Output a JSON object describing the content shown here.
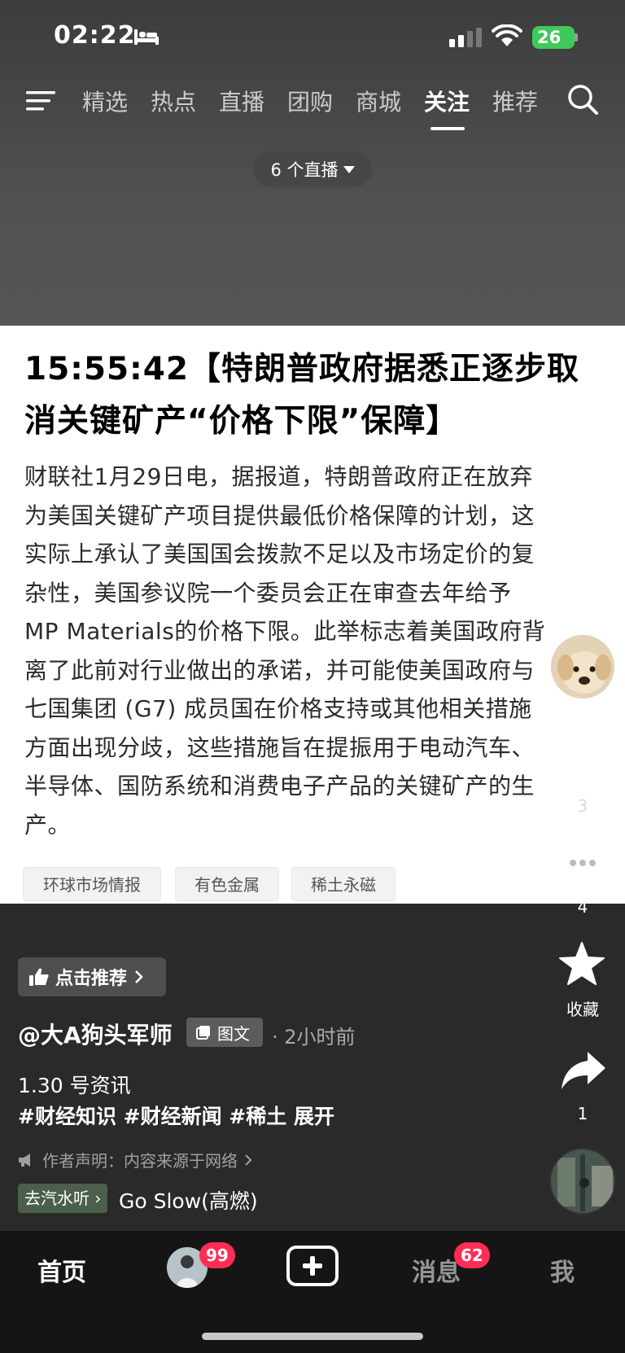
{
  "status_bar": {
    "time": "02:22",
    "battery": "26"
  },
  "nav": {
    "tabs": [
      "精选",
      "热点",
      "直播",
      "团购",
      "商城",
      "关注",
      "推荐"
    ],
    "active": "关注"
  },
  "live_pill": {
    "label": "6 个直播"
  },
  "article": {
    "title_line1": "15:55:42【特朗普政府据悉正逐步取",
    "title_line2": "消关键矿产“价格下限”保障】",
    "body_lines": [
      "财联社1月29日电，据报道，特朗普政府正在放弃",
      "为美国关键矿产项目提供最低价格保障的计划，这",
      "实际上承认了美国国会拨款不足以及市场定价的复",
      "杂性，美国参议院一个委员会正在审查去年给予",
      "MP Materials的价格下限。此举标志着美国政府背",
      "离了此前对行业做出的承诺，并可能使美国政府与",
      "七国集团 (G7) 成员国在价格支持或其他相关措施",
      "方面出现分歧，这些措施旨在提振用于电动汽车、",
      "半导体、国防系统和消费电子产品的关键矿产的生",
      "产。"
    ],
    "tags": [
      "环球市场情报",
      "有色金属",
      "稀土永磁"
    ]
  },
  "side_actions": {
    "like_count": "3",
    "comment_count": "4",
    "favorite_label": "收藏",
    "share_count": "1"
  },
  "post": {
    "recommend_label": "点击推荐",
    "author": "@大A狗头军师",
    "type_badge": "图文",
    "time_ago": "· 2小时前",
    "caption": "1.30 号资讯",
    "hashtags": "#财经知识 #财经新闻 #稀土  展开",
    "statement": "作者声明：内容来源于网络",
    "music_tag": "去汽水听",
    "music_title": "Go Slow(高燃)"
  },
  "tabbar": {
    "home": "首页",
    "friend_badge": "99",
    "messages": "消息",
    "messages_badge": "62",
    "me": "我"
  },
  "colors": {
    "battery": "#3fc95a",
    "badge": "#ff2d55",
    "tabbar_bg": "#151515"
  }
}
